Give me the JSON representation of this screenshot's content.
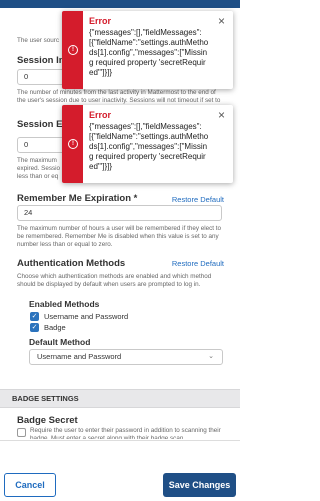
{
  "sections": {
    "session_length_help_fragment": "The user sourc",
    "session_idle": {
      "label_fragment": "Session Inac",
      "value": "0",
      "help_fragment": "The number of minutes from the last activity in Mattermost to the end of the user's session due to user inactivity. Sessions will not timeout if set to any number less tha"
    },
    "session_expiry": {
      "label_fragment": "Session Expir",
      "value": "0",
      "help_fragment": "The maximum expired. Sessio less than or eq"
    },
    "remember_me": {
      "label": "Remember Me Expiration *",
      "restore_label": "Restore Default",
      "value": "24",
      "help": "The maximum number of hours a user will be remembered if they elect to be remembered. Remember Me is disabled when this value is set to any number less than or equal to zero."
    },
    "auth_methods": {
      "label": "Authentication Methods",
      "restore_label": "Restore Default",
      "help": "Choose which authentication methods are enabled and which method should be displayed by default when users are prompted to log in.",
      "enabled_label": "Enabled Methods",
      "options": [
        {
          "label": "Username and Password",
          "checked": true
        },
        {
          "label": "Badge",
          "checked": true
        }
      ],
      "default_label": "Default Method",
      "default_value": "Username and Password"
    },
    "badge_settings": {
      "header": "BADGE SETTINGS",
      "secret_label": "Badge Secret",
      "secret_help": "Require the user to enter their password in addition to scanning their badge. Must enter a secret along with their badge scan."
    }
  },
  "toasts": [
    {
      "title": "Error",
      "body": "{\"messages\":[],\"fieldMessages\":[{\"fieldName\":\"settings.authMethods[1].config\",\"messages\":[\"Missing required property 'secretRequired'\"]}]}"
    },
    {
      "title": "Error",
      "body": "{\"messages\":[],\"fieldMessages\":[{\"fieldName\":\"settings.authMethods[1].config\",\"messages\":[\"Missing required property 'secretRequired'\"]}]}"
    }
  ],
  "footer": {
    "cancel_label": "Cancel",
    "save_label": "Save Changes"
  },
  "colors": {
    "primary": "#1f4f86",
    "link": "#1f6bbf",
    "error": "#d41c2c"
  }
}
